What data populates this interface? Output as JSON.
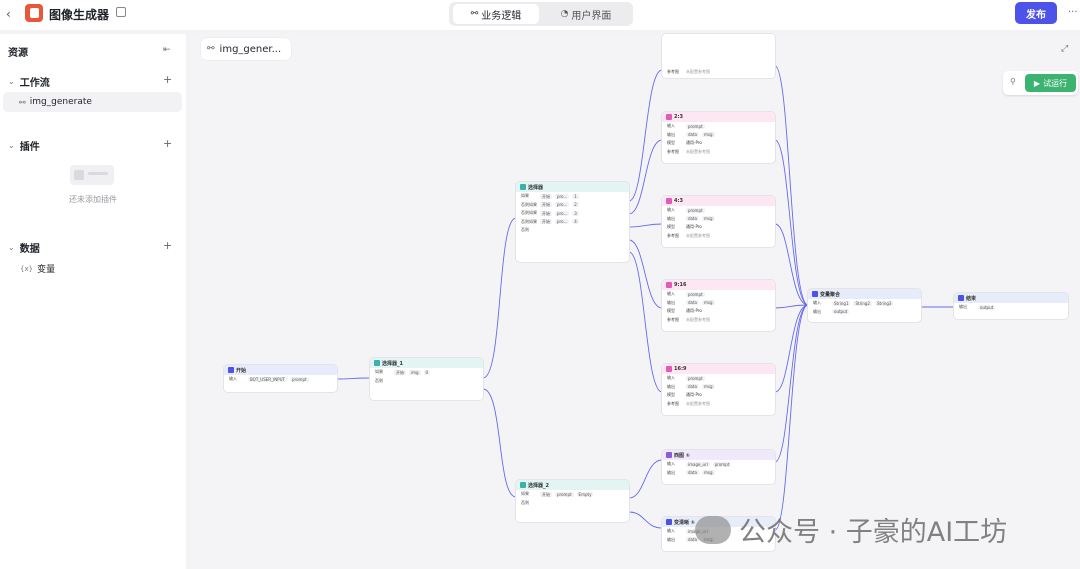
{
  "app": {
    "title": "图像生成器",
    "back_icon": "chevron-left-icon"
  },
  "tabs": [
    {
      "label": "业务逻辑",
      "active": true
    },
    {
      "label": "用户界面",
      "active": false
    }
  ],
  "publish_label": "发布",
  "sidebar": {
    "title": "资源",
    "workflow": {
      "label": "工作流",
      "items": [
        "img_generate"
      ]
    },
    "plugins": {
      "label": "插件",
      "empty_text": "还未添加插件"
    },
    "data": {
      "label": "数据",
      "items": [
        "变量"
      ],
      "var_icon": "{x}"
    }
  },
  "canvas": {
    "tab_label": "img_gener...",
    "run_label": "试运行"
  },
  "nodes": {
    "start": {
      "title": "开始",
      "input_label": "输入",
      "input_a": "BOT_USER_INPUT",
      "input_b": "prompt"
    },
    "sel1": {
      "title": "选择器_1",
      "if": "如果",
      "else": "否则",
      "c1": "开始",
      "c2": "img",
      "c3": "0"
    },
    "sel": {
      "title": "选择器",
      "rows": [
        {
          "k": "如果",
          "v": "1"
        },
        {
          "k": "否则如果",
          "v": "2"
        },
        {
          "k": "否则如果",
          "v": "3"
        },
        {
          "k": "否则如果",
          "v": "4"
        }
      ],
      "else": "否则",
      "src": "开始",
      "var": "pro..."
    },
    "sel2": {
      "title": "选择器_2",
      "if": "如果",
      "else": "否则",
      "c1": "开始",
      "c2": "prompt",
      "c3": "Empty"
    },
    "img_top": {
      "ref_label": "参考图",
      "ref_val": "未配置参考图"
    },
    "img": [
      {
        "title": "2:3"
      },
      {
        "title": "4:3"
      },
      {
        "title": "9:16"
      },
      {
        "title": "16:9"
      }
    ],
    "img_fields": {
      "in": "输入",
      "out": "输出",
      "model": "模型",
      "ref": "参考图",
      "prompt": "prompt",
      "data": "data",
      "msg": "msg",
      "model_val": "通用-Pro",
      "ref_val": "未配置参考图"
    },
    "plugin1": {
      "title": "西图 ①",
      "in": "输入",
      "out": "输出",
      "a": "image_url",
      "b": "prompt",
      "c": "data",
      "d": "msg"
    },
    "plugin2": {
      "title": "变清晰 ①",
      "in": "输入",
      "out": "输出",
      "a": "image_url",
      "c": "data",
      "d": "msg"
    },
    "merge": {
      "title": "变量聚合",
      "in": "输入",
      "out": "输出",
      "a": "String1",
      "b": "String2",
      "c": "String3",
      "o": "output"
    },
    "end": {
      "title": "结束",
      "out": "输出",
      "o": "output"
    }
  },
  "watermark": "公众号 · 子豪的AI工坊",
  "colors": {
    "accent": "#4d53e8",
    "run": "#3cb371",
    "img_header": "#fde7f3",
    "sel_header": "#e2f5f3",
    "merge_header": "#e7ecfb"
  }
}
